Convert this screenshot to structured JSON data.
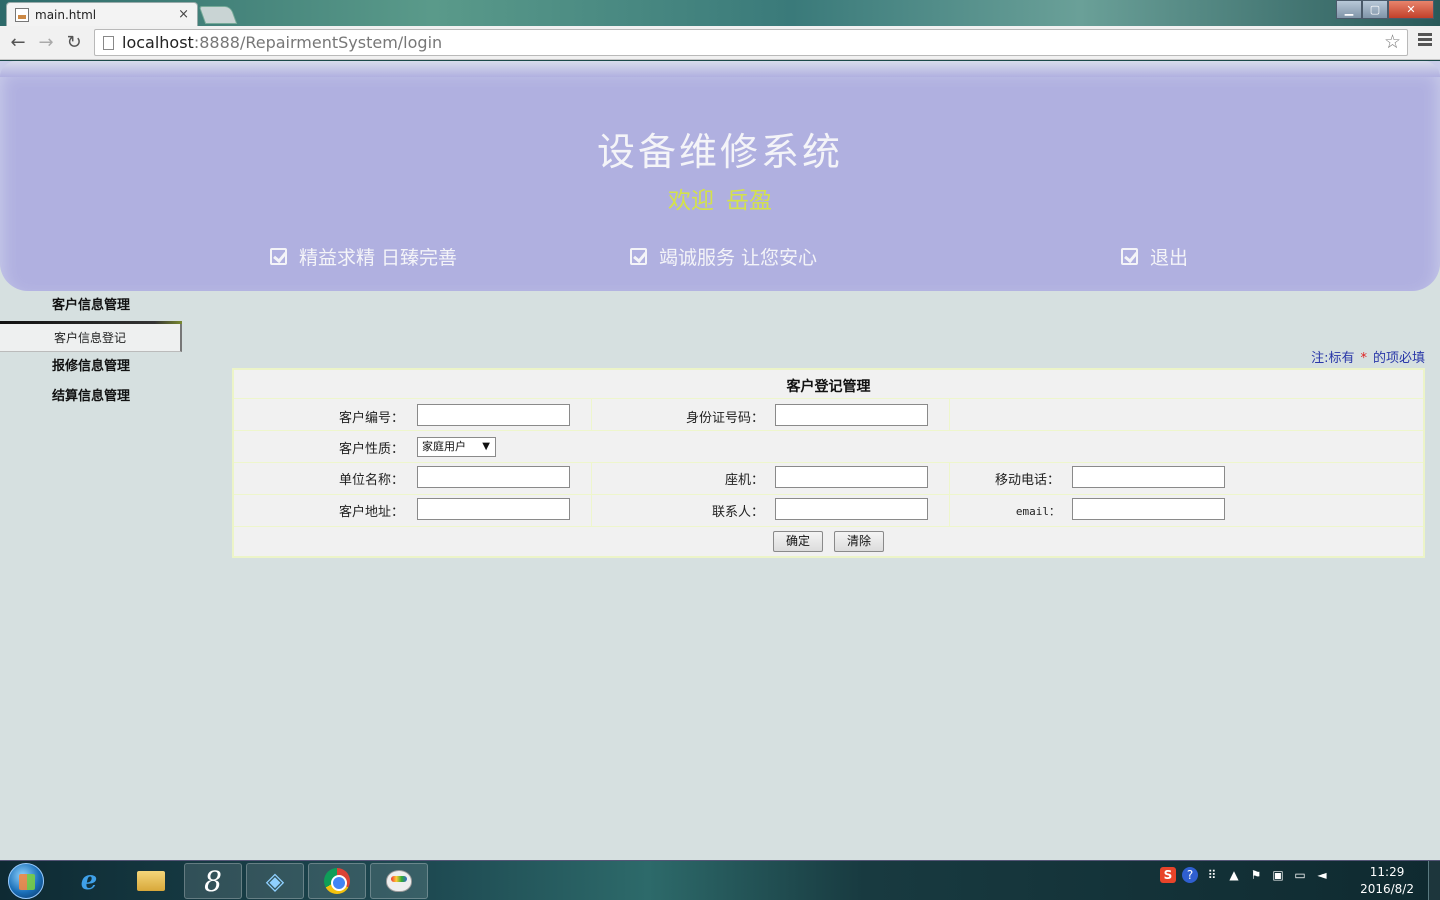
{
  "browser": {
    "tab_title": "main.html",
    "tab_close": "×",
    "url_host": "localhost",
    "url_rest": ":8888/RepairmentSystem/login",
    "back": "←",
    "forward": "→",
    "reload": "↻",
    "star": "☆",
    "win_min": "▁",
    "win_max": "▢",
    "win_close": "✕"
  },
  "banner": {
    "title": "设备维修系统",
    "welcome_prefix": "欢迎",
    "welcome_user": "岳盈",
    "nav": [
      "精益求精 日臻完善",
      "竭诚服务 让您安心",
      "退出"
    ]
  },
  "sidebar": {
    "sections": [
      {
        "title": "客户信息管理",
        "items": [
          "客户信息登记"
        ]
      },
      {
        "title": "报修信息管理"
      },
      {
        "title": "结算信息管理"
      }
    ]
  },
  "note": {
    "prefix": "注:标有",
    "star": "*",
    "suffix": "的项必填"
  },
  "form": {
    "caption": "客户登记管理",
    "labels": {
      "customer_id": "客户编号：",
      "id_card": "身份证号码：",
      "customer_type": "客户性质：",
      "company": "单位名称：",
      "landline": "座机：",
      "mobile": "移动电话：",
      "address": "客户地址：",
      "contact": "联系人：",
      "email": "email："
    },
    "values": {
      "customer_id": "",
      "id_card": "",
      "company": "",
      "landline": "",
      "mobile": "",
      "address": "",
      "contact": "",
      "email": ""
    },
    "customer_type_selected": "家庭用户",
    "customer_type_arrow": "▼",
    "buttons": {
      "confirm": "确定",
      "clear": "清除"
    }
  },
  "taskbar": {
    "time": "11:29",
    "date": "2016/8/2",
    "ie_label": "e",
    "eight_label": "8",
    "tray_sogou": "S",
    "tray_help": "?"
  },
  "colors": {
    "banner_bg": "#b0b0e0",
    "page_bg": "#d6e0e0",
    "welcome": "#d4e24a",
    "note_text": "#2a38a8",
    "required_star": "#e02020"
  }
}
